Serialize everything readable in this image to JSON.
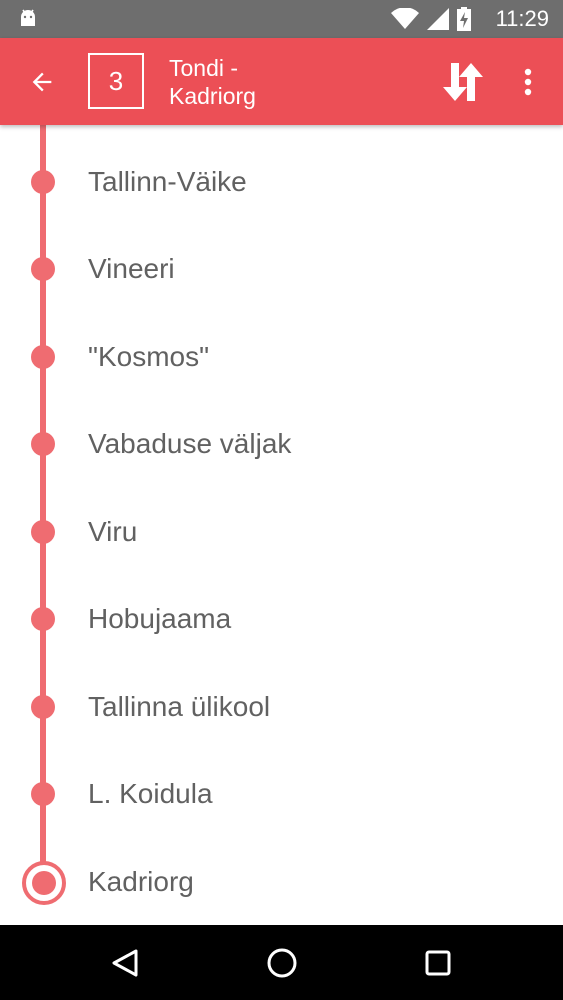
{
  "status_bar": {
    "time": "11:29",
    "icons": [
      "android-icon",
      "wifi-icon",
      "cell-signal-icon",
      "battery-charging-icon"
    ]
  },
  "app_bar": {
    "route_number": "3",
    "route_title_line1": "Tondi -",
    "route_title_line2": "Kadriorg",
    "icons": [
      "back-arrow-icon",
      "swap-direction-icon",
      "more-vert-icon"
    ]
  },
  "stops": [
    {
      "name": "Tallinn-Väike"
    },
    {
      "name": "Vineeri"
    },
    {
      "name": "\"Kosmos\""
    },
    {
      "name": "Vabaduse väljak"
    },
    {
      "name": "Viru"
    },
    {
      "name": "Hobujaama"
    },
    {
      "name": "Tallinna ülikool"
    },
    {
      "name": "L. Koidula"
    },
    {
      "name": "Kadriorg"
    }
  ],
  "nav_bar": {
    "icons": [
      "back-triangle-icon",
      "home-circle-icon",
      "recents-square-icon"
    ]
  },
  "colors": {
    "accent": "#ec4f56",
    "timeline": "#ef6c71",
    "status_bar": "#6e6e6e",
    "text": "#616161"
  }
}
